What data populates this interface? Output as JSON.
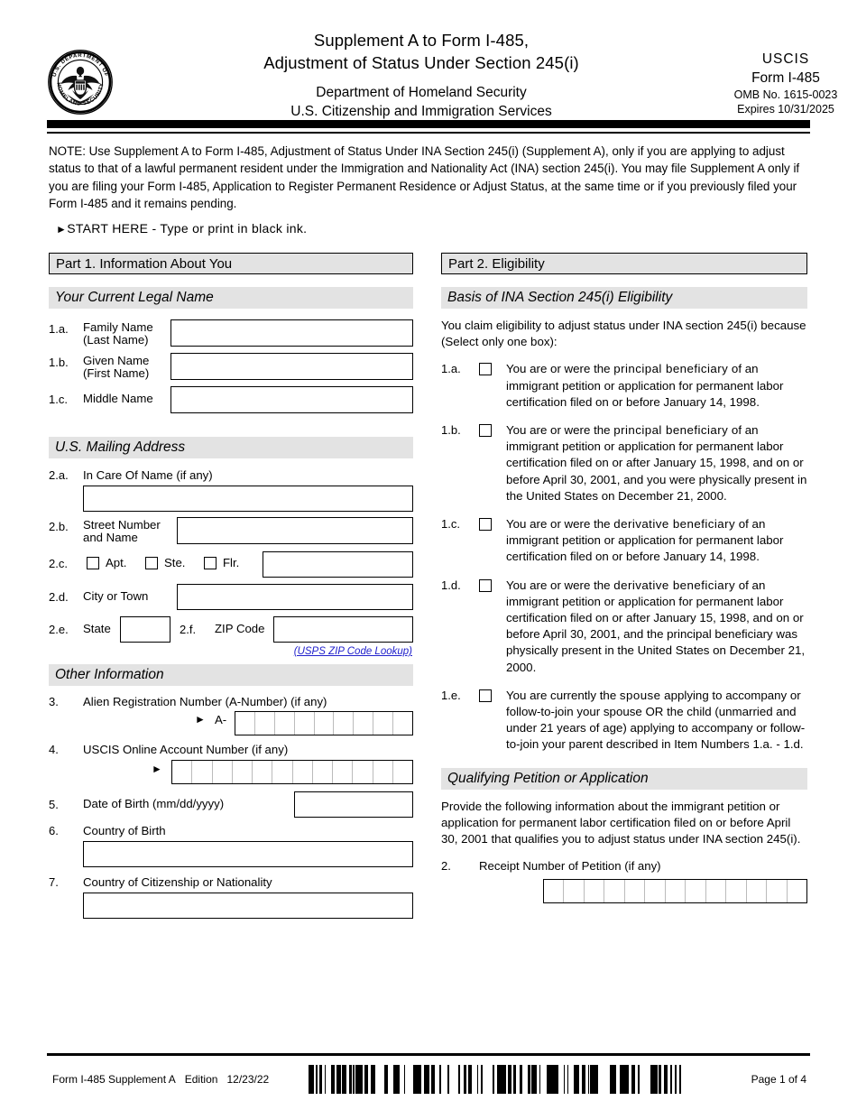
{
  "header": {
    "title_line1": "Supplement A to Form I-485,",
    "title_line2": "Adjustment of Status Under Section 245(i)",
    "agency_line1": "Department of Homeland Security",
    "agency_line2": "U.S. Citizenship and Immigration Services",
    "uscis": "USCIS",
    "form_no": "Form I-485",
    "omb": "OMB No. 1615-0023",
    "expires": "Expires 10/31/2025",
    "seal_text_top": "U.S. DEPARTMENT OF",
    "seal_text_bottom": "HOMELAND SECURITY"
  },
  "note": {
    "text": "NOTE:  Use Supplement A to Form I-485, Adjustment of Status Under INA Section 245(i) (Supplement A), only if you are applying to adjust status to that of a lawful permanent resident under the Immigration and Nationality Act (INA) section 245(i).  You may file Supplement A only if you are filing your Form I-485, Application to Register Permanent Residence or Adjust Status, at the same time or if you previously filed your Form I-485 and it remains pending.",
    "start_here": "START HERE - Type or print in black ink."
  },
  "part1": {
    "title": "Part 1.  Information About You",
    "legal_name_header": "Your Current Legal Name",
    "mailing_header": "U.S. Mailing Address",
    "other_header": "Other Information",
    "items": {
      "n1a": "1.a.",
      "n1b": "1.b.",
      "n1c": "1.c.",
      "n2a": "2.a.",
      "n2b": "2.b.",
      "n2c": "2.c.",
      "n2d": "2.d.",
      "n2e": "2.e.",
      "n2f": "2.f.",
      "n3": "3.",
      "n4": "4.",
      "n5": "5.",
      "n6": "6.",
      "n7": "7."
    },
    "labels": {
      "family_name_l1": "Family Name",
      "family_name_l2": "(Last Name)",
      "given_name_l1": "Given Name",
      "given_name_l2": "(First Name)",
      "middle_name": "Middle Name",
      "in_care_of": "In Care Of Name (if any)",
      "street_l1": "Street Number",
      "street_l2": "and Name",
      "apt": "Apt.",
      "ste": "Ste.",
      "flr": "Flr.",
      "city_or_town": "City or Town",
      "state": "State",
      "zip_code": "ZIP Code",
      "zip_lookup": "(USPS ZIP Code Lookup)",
      "a_number": "Alien Registration Number (A-Number) (if any)",
      "a_prefix": "A-",
      "uscis_online": "USCIS Online Account Number (if any)",
      "date_of_birth": "Date of Birth (mm/dd/yyyy)",
      "country_of_birth": "Country of Birth",
      "country_of_citizenship": "Country of Citizenship or Nationality"
    },
    "values": {
      "family_name": "",
      "given_name": "",
      "middle_name": "",
      "in_care_of": "",
      "street": "",
      "apt_checked": false,
      "ste_checked": false,
      "flr_checked": false,
      "apt_ste_flr_value": "",
      "city_or_town": "",
      "state": "",
      "zip_code": "",
      "date_of_birth": "",
      "country_of_birth": "",
      "country_of_citizenship": ""
    },
    "cell_counts": {
      "a_number": 9,
      "uscis_online": 12
    }
  },
  "part2": {
    "title": "Part 2.  Eligibility",
    "basis_header": "Basis of INA Section 245(i) Eligibility",
    "intro": "You claim eligibility to adjust status under INA section 245(i) because (Select only one box):",
    "options": [
      {
        "num": "1.a.",
        "checked": false,
        "text_pre": "You are or were the ",
        "text_em": "principal beneficiary",
        "text_post": " of an immigrant petition or application for permanent labor certification filed on or before January 14, 1998."
      },
      {
        "num": "1.b.",
        "checked": false,
        "text_pre": "You are or were the ",
        "text_em": "principal beneficiary",
        "text_post": " of an immigrant petition or application for permanent labor certification filed on or after January 15, 1998, and on or before April 30, 2001, and you were physically present in the United States on December 21, 2000."
      },
      {
        "num": "1.c.",
        "checked": false,
        "text_pre": "You are or were the ",
        "text_em": "derivative beneficiary",
        "text_post": " of an immigrant petition or application for permanent labor certification filed on or before January 14, 1998."
      },
      {
        "num": "1.d.",
        "checked": false,
        "text_pre": "You are or were the ",
        "text_em": "derivative beneficiary",
        "text_post": " of an immigrant petition or application for permanent labor certification filed on or after January 15, 1998, and on or before April 30, 2001, and the principal beneficiary was physically present in the United States on December 21, 2000."
      },
      {
        "num": "1.e.",
        "checked": false,
        "text_pre": "You are currently the ",
        "text_em": "spouse",
        "text_post": " applying to accompany or follow-to-join your spouse OR the child (unmarried and under 21 years of age) applying to accompany or follow-to-join your parent described in Item Numbers 1.a. - 1.d."
      }
    ],
    "qualifying_header": "Qualifying Petition or Application",
    "qualifying_intro": "Provide the following information about the immigrant petition or application for permanent labor certification filed on or before April 30, 2001 that qualifies you to adjust status under INA section 245(i).",
    "receipt_num": "2.",
    "receipt_label": "Receipt Number of Petition (if any)",
    "receipt_value": "",
    "receipt_cells": 13
  },
  "footer": {
    "form_name": "Form I-485 Supplement A",
    "edition_label": "Edition",
    "edition_date": "12/23/22",
    "page": "Page 1 of 4",
    "barcode_alt": "barcode"
  },
  "colors": {
    "section_grey": "#e3e3e3",
    "link_blue": "#2222cc",
    "ink": "#000000"
  }
}
